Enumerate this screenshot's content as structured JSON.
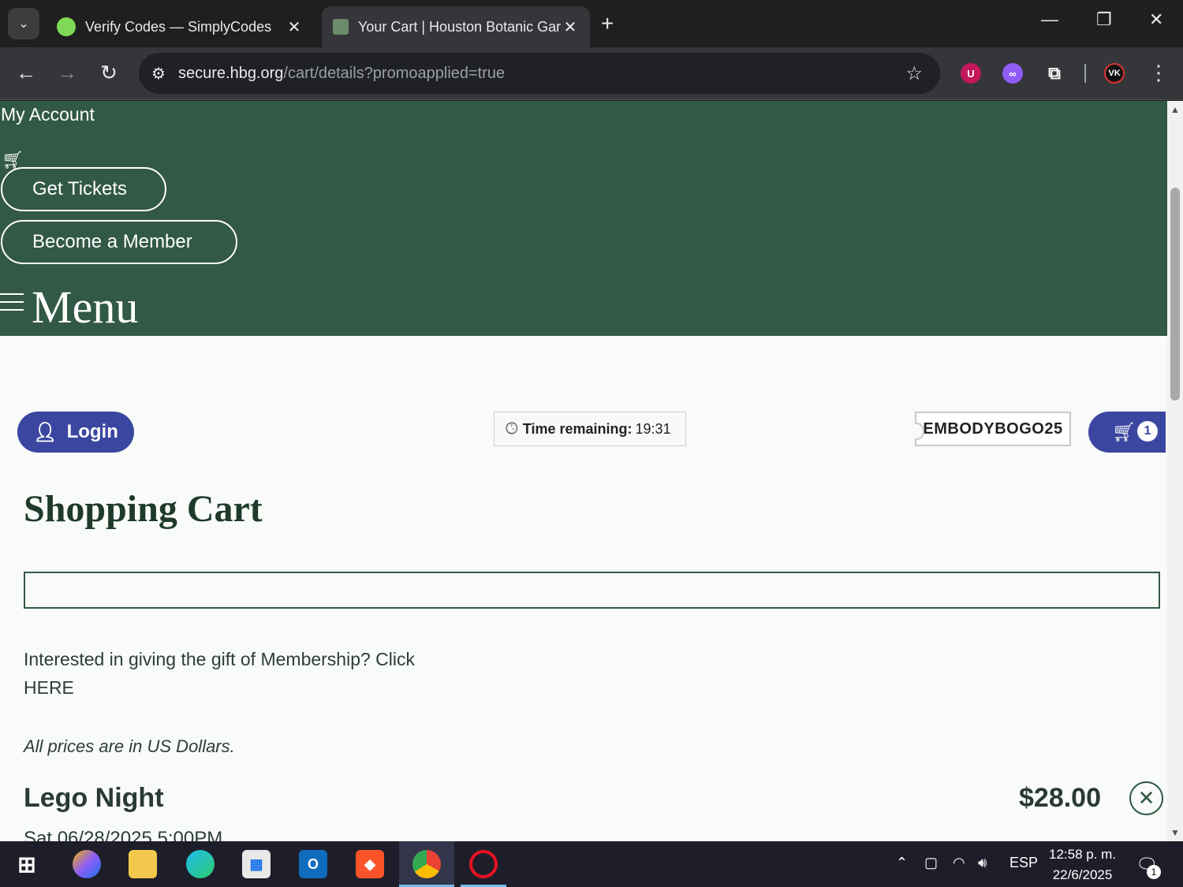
{
  "browser": {
    "tabs": [
      {
        "title": "Verify Codes — SimplyCodes",
        "active": false
      },
      {
        "title": "Your Cart | Houston Botanic Gar",
        "active": true
      }
    ],
    "url_host": "secure.hbg.org",
    "url_path": "/cart/details?promoapplied=true",
    "extensions": [
      "ublock-icon",
      "ai-icon",
      "extensions-puzzle-icon",
      "vk-icon"
    ]
  },
  "header": {
    "my_account": "My Account",
    "get_tickets": "Get Tickets",
    "become_member": "Become a Member",
    "menu": "Menu"
  },
  "utility": {
    "login": "Login",
    "time_label": "Time remaining:",
    "time_value": "19:31",
    "promo_code": "EMBODYBOGO25",
    "cart_count": "1"
  },
  "cart": {
    "title": "Shopping Cart",
    "gift_text": "Interested in giving the gift of Membership? Click HERE",
    "prices_note": "All prices are in US Dollars.",
    "items": [
      {
        "name": "Lego Night",
        "price": "$28.00",
        "date": "Sat 06/28/2025 5:00PM"
      }
    ]
  },
  "taskbar": {
    "language": "ESP",
    "time": "12:58 p. m.",
    "date": "22/6/2025",
    "notifications": "1"
  },
  "colors": {
    "header_green": "#325846",
    "button_blue": "#3a46a0",
    "page_bg": "#f8fbf8"
  }
}
